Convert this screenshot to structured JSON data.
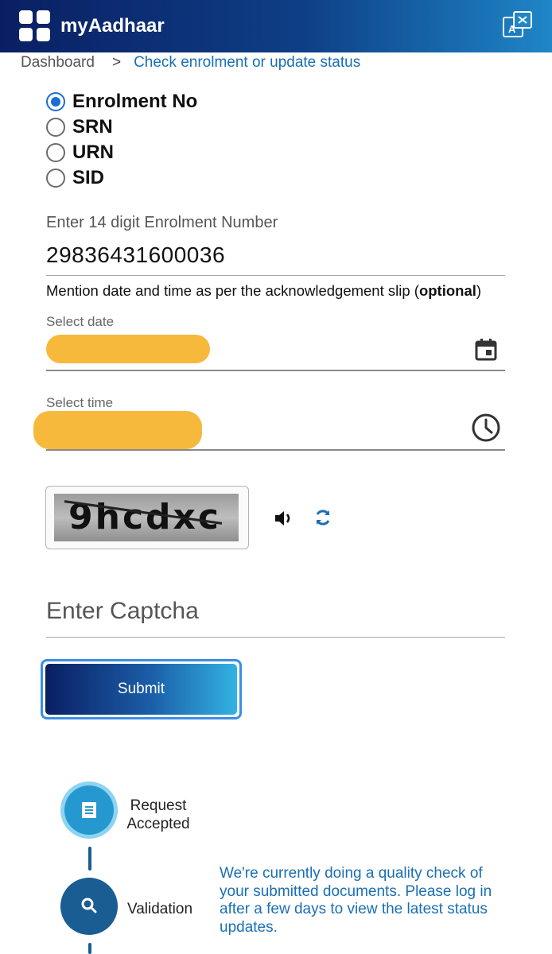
{
  "app": {
    "title": "myAadhaar",
    "brand_color": "#0a1f63",
    "accent_color": "#1f86c8"
  },
  "breadcrumb": {
    "home": "Dashboard",
    "separator": ">",
    "current": "Check enrolment or update status"
  },
  "id_type": {
    "options": [
      "Enrolment No",
      "SRN",
      "URN",
      "SID"
    ],
    "selected": "Enrolment No"
  },
  "enrolment": {
    "label": "Enter 14 digit Enrolment Number",
    "value": "29836431600036"
  },
  "note": {
    "text": "Mention date and time as per the acknowledgement slip (",
    "emphasis": "optional",
    "suffix": ")"
  },
  "date_field": {
    "label": "Select date",
    "icon": "calendar-icon"
  },
  "time_field": {
    "label": "Select time",
    "icon": "clock-icon"
  },
  "captcha": {
    "image_text": "9hcdxc",
    "placeholder": "Enter Captcha",
    "audio_icon": "speaker-icon",
    "refresh_icon": "refresh-icon"
  },
  "submit_label": "Submit",
  "progress": {
    "steps": [
      {
        "label_line1": "Request",
        "label_line2": "Accepted",
        "icon": "document-icon"
      },
      {
        "label_line1": "Validation",
        "icon": "search-icon"
      }
    ],
    "status_message": "We're currently doing a quality check of your submitted documents. Please log in after a few days to view the latest status updates."
  }
}
